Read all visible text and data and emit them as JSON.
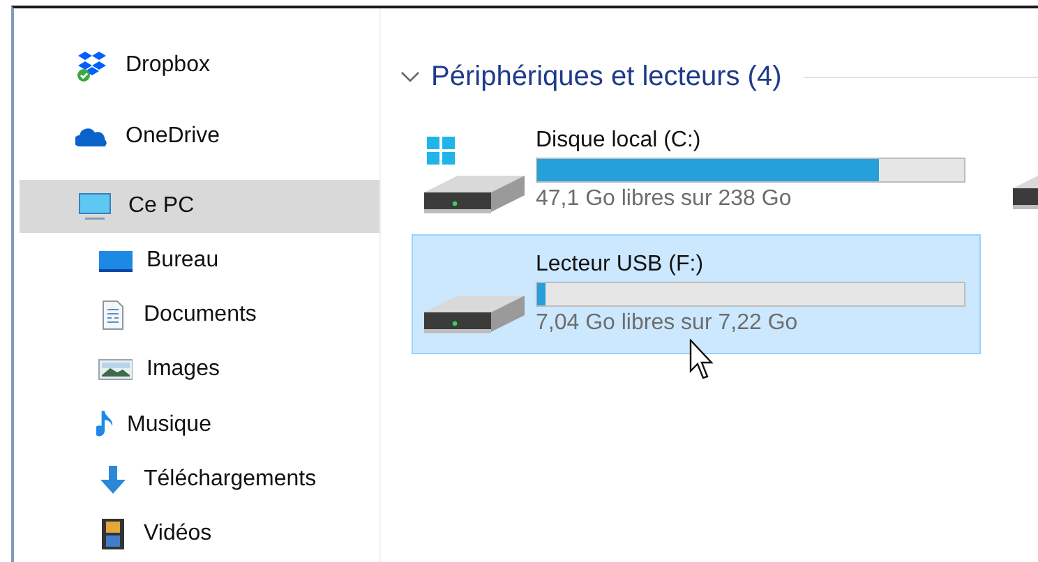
{
  "sidebar": {
    "items": [
      {
        "label": "Dropbox",
        "selected": false
      },
      {
        "label": "OneDrive",
        "selected": false
      },
      {
        "label": "Ce PC",
        "selected": true,
        "expanded": true,
        "children": [
          {
            "label": "Bureau",
            "selected": false
          },
          {
            "label": "Documents",
            "selected": false
          },
          {
            "label": "Images",
            "selected": false
          },
          {
            "label": "Musique",
            "selected": false
          },
          {
            "label": "Téléchargements",
            "selected": false
          },
          {
            "label": "Vidéos",
            "selected": false
          }
        ]
      }
    ]
  },
  "section": {
    "title": "Périphériques et lecteurs (4)",
    "expanded": true,
    "drives": [
      {
        "kind": "system",
        "name": "Disque local (C:)",
        "level": 0.8,
        "free": "47,1 Go libres sur 238 Go",
        "selected": false
      },
      {
        "kind": "removable",
        "name": "Lecteur USB (F:)",
        "level": 0.02,
        "free": "7,04 Go libres sur 7,22 Go",
        "selected": true
      },
      {
        "kind": "drive",
        "selected": false
      }
    ]
  }
}
